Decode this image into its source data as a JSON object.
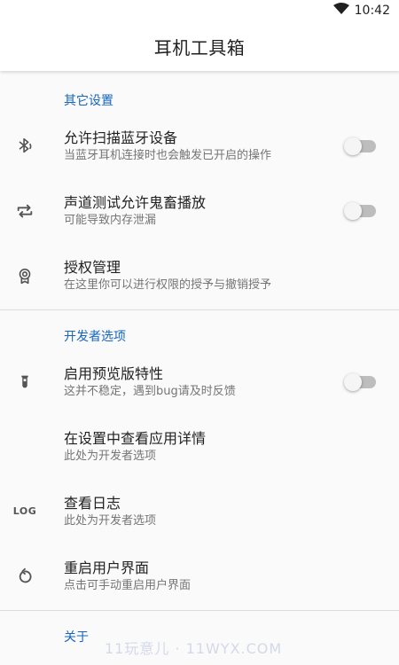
{
  "status_bar": {
    "time": "10:42",
    "icons": [
      "wifi-icon",
      "battery-icon"
    ]
  },
  "app_bar": {
    "title": "耳机工具箱"
  },
  "sections": {
    "other": {
      "header": "其它设置",
      "items": [
        {
          "title": "允许扫描蓝牙设备",
          "summary": "当蓝牙耳机连接时也会触发已开启的操作",
          "icon": "bluetooth-audio-icon",
          "switch": false
        },
        {
          "title": "声道测试允许鬼畜播放",
          "summary": "可能导致内存泄漏",
          "icon": "repeat-icon",
          "switch": false
        },
        {
          "title": "授权管理",
          "summary": "在这里你可以进行权限的授予与撤销授予",
          "icon": "badge-icon"
        }
      ]
    },
    "developer": {
      "header": "开发者选项",
      "items": [
        {
          "title": "启用预览版特性",
          "summary": "这并不稳定，遇到bug请及时反馈",
          "icon": "test-tube-icon",
          "switch": false
        },
        {
          "title": "在设置中查看应用详情",
          "summary": "此处为开发者选项"
        },
        {
          "title": "查看日志",
          "summary": "此处为开发者选项",
          "icon": "log-icon",
          "icon_text": "LOG"
        },
        {
          "title": "重启用户界面",
          "summary": "点击可手动重启用户界面",
          "icon": "restart-icon"
        }
      ]
    },
    "about": {
      "header": "关于"
    }
  },
  "watermark": "11玩意儿 · 11WYX.COM",
  "colors": {
    "accent": "#1565c0",
    "switch_off_track": "#bdbdbd",
    "switch_off_thumb": "#f5f5f5"
  }
}
